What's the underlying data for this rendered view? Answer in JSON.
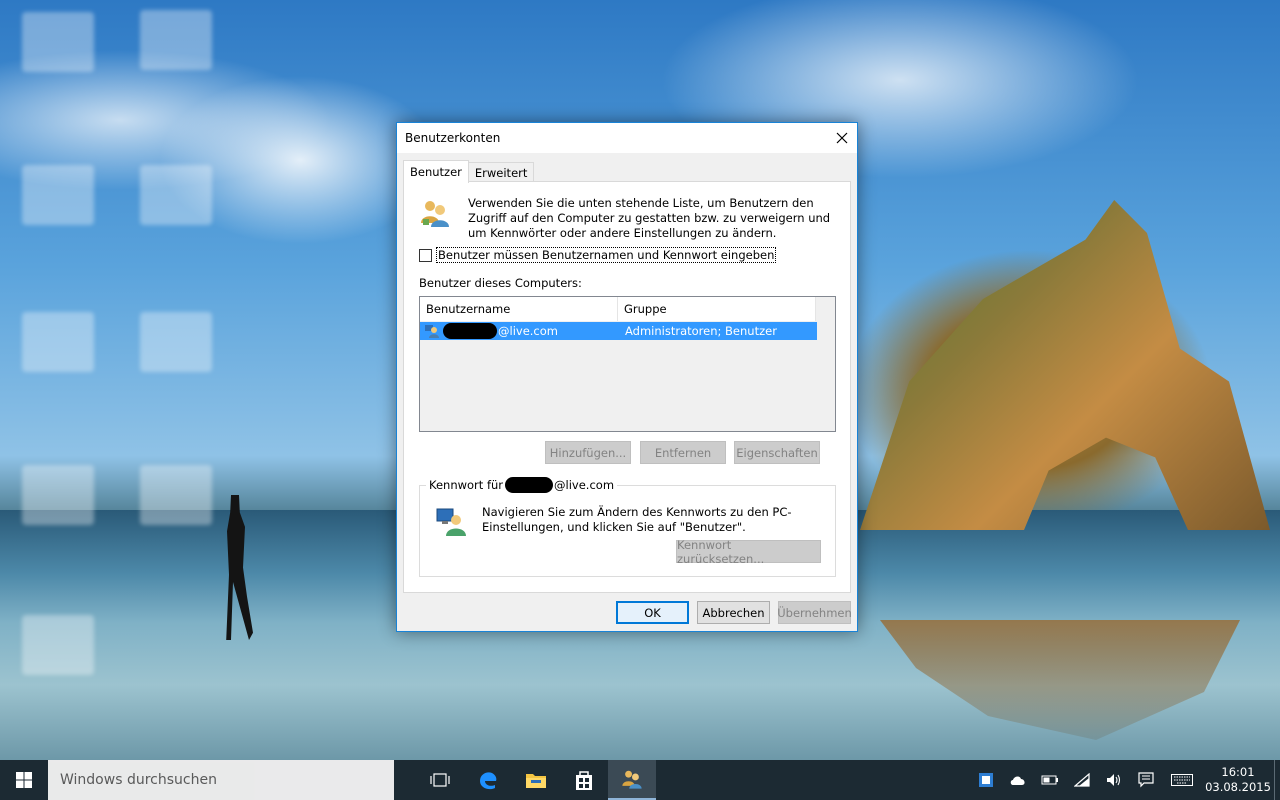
{
  "dialog": {
    "title": "Benutzerkonten",
    "tabs": [
      {
        "label": "Benutzer",
        "active": true
      },
      {
        "label": "Erweitert",
        "active": false
      }
    ],
    "intro_text": "Verwenden Sie die unten stehende Liste, um Benutzern den Zugriff auf den Computer zu gestatten bzw. zu verweigern und um Kennwörter oder andere Einstellungen zu ändern.",
    "checkbox": {
      "label": "Benutzer müssen Benutzernamen und Kennwort eingeben",
      "checked": false
    },
    "list_caption": "Benutzer dieses Computers:",
    "list": {
      "columns": [
        "Benutzername",
        "Gruppe"
      ],
      "rows": [
        {
          "username_suffix": "@live.com",
          "group": "Administratoren; Benutzer",
          "selected": true
        }
      ]
    },
    "list_buttons": {
      "add": "Hinzufügen...",
      "remove": "Entfernen",
      "properties": "Eigenschaften"
    },
    "password_group": {
      "legend_prefix": "Kennwort für",
      "legend_suffix": "@live.com",
      "text": "Navigieren Sie zum Ändern des Kennworts zu den PC-Einstellungen, und klicken Sie auf \"Benutzer\".",
      "reset_button": "Kennwort zurücksetzen..."
    },
    "footer_buttons": {
      "ok": "OK",
      "cancel": "Abbrechen",
      "apply": "Übernehmen"
    }
  },
  "taskbar": {
    "search_placeholder": "Windows durchsuchen",
    "clock_time": "16:01",
    "clock_date": "03.08.2015"
  },
  "colors": {
    "accent": "#1883d7",
    "selection": "#3399ff",
    "taskbar": "#1c2a33"
  }
}
